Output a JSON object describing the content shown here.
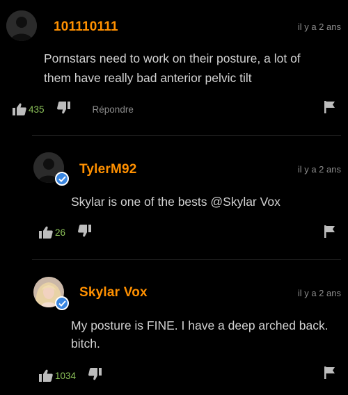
{
  "comments": [
    {
      "username": "101110111",
      "timestamp": "il y a 2 ans",
      "lines": [
        "Pornstars need to work on their posture, a lot of",
        "them have really bad anterior pelvic tilt"
      ],
      "upvotes": "435",
      "reply_label": "Répondre",
      "avatar": "default-avatar",
      "verified": false
    },
    {
      "username": "TylerM92",
      "timestamp": "il y a 2 ans",
      "lines": [
        "Skylar is one of the bests @Skylar Vox"
      ],
      "upvotes": "26",
      "avatar": "default-avatar",
      "verified": true
    },
    {
      "username": "Skylar Vox",
      "timestamp": "il y a 2 ans",
      "lines": [
        "My posture is FINE. I have a deep arched back.",
        "bitch."
      ],
      "upvotes": "1034",
      "avatar": "profile-photo",
      "verified": true
    }
  ],
  "icons": {
    "upvote": "thumbs-up-icon",
    "downvote": "thumbs-down-icon",
    "report": "flag-icon",
    "verified": "checkmark-badge-icon"
  },
  "colors": {
    "background": "#000000",
    "username": "#ff9000",
    "upvote_count": "#8dc35a",
    "timestamp": "#8c8c8c",
    "verified_badge": "#3a86e0"
  }
}
